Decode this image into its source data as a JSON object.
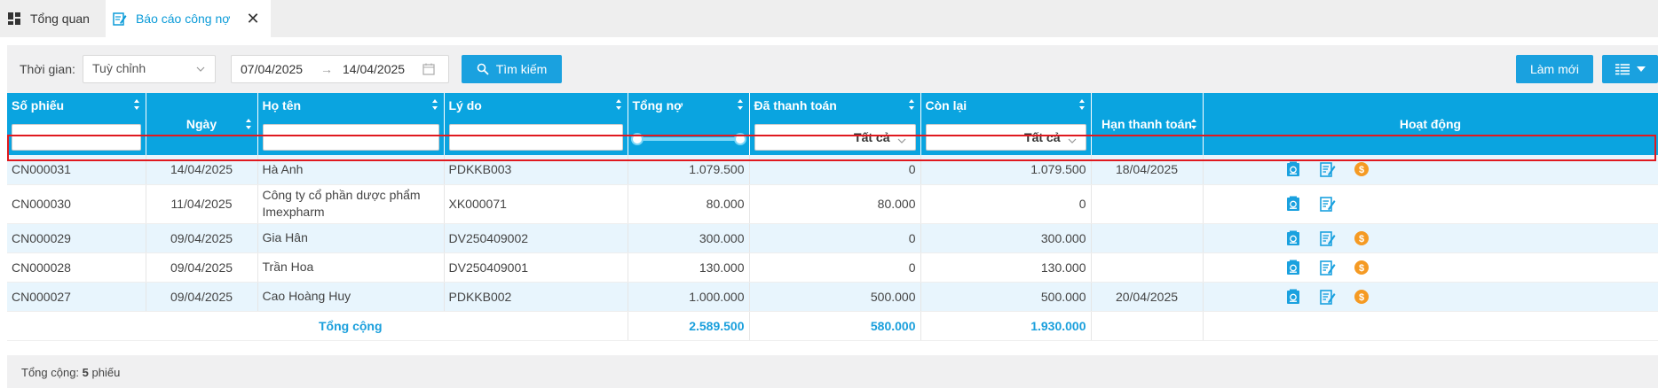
{
  "tabs": [
    {
      "label": "Tổng quan",
      "icon": "dashboard-icon",
      "active": false
    },
    {
      "label": "Báo cáo công nợ",
      "icon": "edit-report-icon",
      "active": true
    }
  ],
  "filter": {
    "time_label": "Thời gian",
    "time_sep": ":",
    "period_value": "Tuỳ chỉnh",
    "date_from": "07/04/2025",
    "date_arrow": "→",
    "date_to": "14/04/2025",
    "search_label": "Tìm kiếm",
    "refresh_label": "Làm mới"
  },
  "columns": {
    "so_phieu": "Số phiếu",
    "ngay": "Ngày",
    "ho_ten": "Họ tên",
    "ly_do": "Lý do",
    "tong_no": "Tổng nợ",
    "da_thanh_toan": "Đã thanh toán",
    "con_lai": "Còn lại",
    "han_thanh_toan": "Hạn thanh toán",
    "hoat_dong": "Hoạt động",
    "filter_all": "Tất cả"
  },
  "rows": [
    {
      "so_phieu": "CN000031",
      "ngay": "14/04/2025",
      "ho_ten": "Hà Anh",
      "ly_do": "PDKKB003",
      "tong_no": "1.079.500",
      "da_thanh_toan": "0",
      "con_lai": "1.079.500",
      "han": "18/04/2025",
      "pay": true
    },
    {
      "so_phieu": "CN000030",
      "ngay": "11/04/2025",
      "ho_ten": "Công ty cổ phần dược phẩm Imexpharm",
      "ly_do": "XK000071",
      "tong_no": "80.000",
      "da_thanh_toan": "80.000",
      "con_lai": "0",
      "han": "",
      "pay": false
    },
    {
      "so_phieu": "CN000029",
      "ngay": "09/04/2025",
      "ho_ten": "Gia Hân",
      "ly_do": "DV250409002",
      "tong_no": "300.000",
      "da_thanh_toan": "0",
      "con_lai": "300.000",
      "han": "",
      "pay": true
    },
    {
      "so_phieu": "CN000028",
      "ngay": "09/04/2025",
      "ho_ten": "Trần Hoa",
      "ly_do": "DV250409001",
      "tong_no": "130.000",
      "da_thanh_toan": "0",
      "con_lai": "130.000",
      "han": "",
      "pay": true
    },
    {
      "so_phieu": "CN000027",
      "ngay": "09/04/2025",
      "ho_ten": "Cao Hoàng Huy",
      "ly_do": "PDKKB002",
      "tong_no": "1.000.000",
      "da_thanh_toan": "500.000",
      "con_lai": "500.000",
      "han": "20/04/2025",
      "pay": true
    }
  ],
  "total": {
    "label": "Tổng cộng",
    "tong_no": "2.589.500",
    "da_thanh_toan": "580.000",
    "con_lai": "1.930.000"
  },
  "footer": {
    "prefix": "Tổng cộng: ",
    "count": "5",
    "suffix": " phiếu"
  },
  "colors": {
    "header_bg": "#0aa4e0",
    "button_bg": "#1aa1df",
    "row_alt": "#e8f5fd",
    "total_text": "#1a9fdc",
    "pay_icon": "#f59a23",
    "highlight": "#e0191f"
  }
}
